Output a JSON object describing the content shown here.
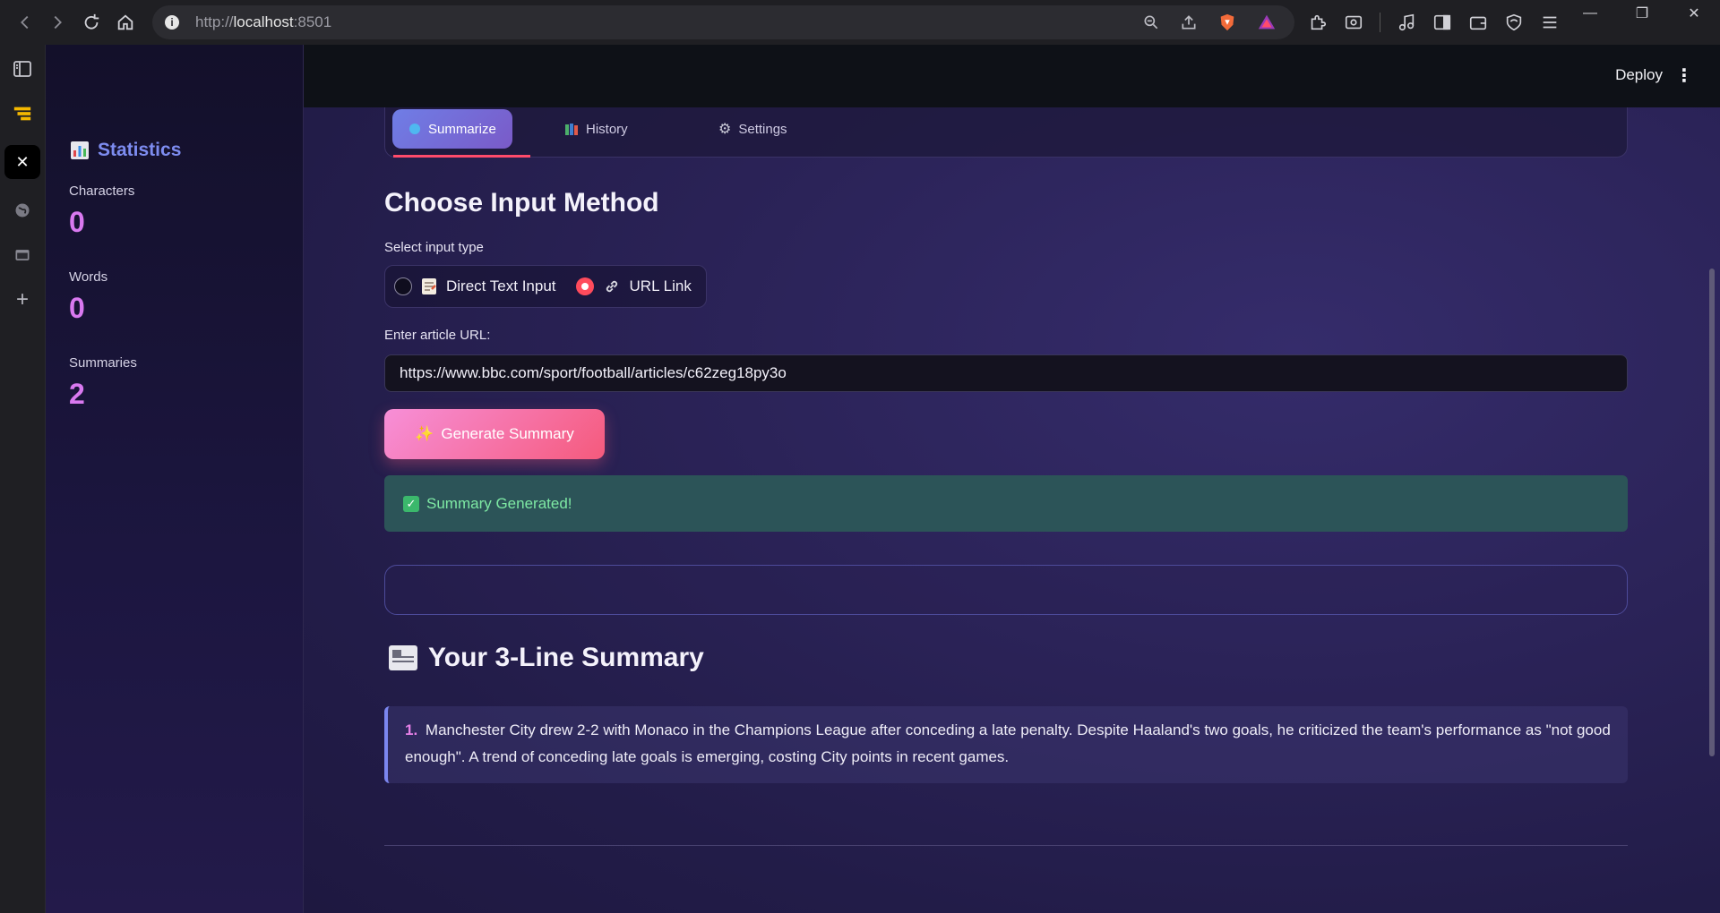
{
  "browser": {
    "url_prefix": "http://",
    "url_host": "localhost",
    "url_port": ":8501"
  },
  "app": {
    "deploy_label": "Deploy"
  },
  "sidebar": {
    "title_icon": "bar-chart-icon",
    "title": "Statistics",
    "stats": [
      {
        "label": "Characters",
        "value": "0"
      },
      {
        "label": "Words",
        "value": "0"
      },
      {
        "label": "Summaries",
        "value": "2"
      }
    ]
  },
  "tabs": [
    {
      "label": "Summarize",
      "icon": "blue-circle-icon",
      "active": true
    },
    {
      "label": "History",
      "icon": "books-icon",
      "active": false
    },
    {
      "label": "Settings",
      "icon": "gear-icon",
      "active": false
    }
  ],
  "input_section": {
    "heading": "Choose Input Method",
    "select_label": "Select input type",
    "options": [
      {
        "label": "Direct Text Input",
        "icon": "memo-icon",
        "selected": false
      },
      {
        "label": "URL Link",
        "icon": "link-icon",
        "selected": true
      }
    ],
    "url_label": "Enter article URL:",
    "url_value": "https://www.bbc.com/sport/football/articles/c62zeg18py3o",
    "generate_label": "Generate Summary",
    "generate_icon": "sparkles-icon"
  },
  "status": {
    "success_text": "Summary Generated!"
  },
  "summary": {
    "heading": "Your 3-Line Summary",
    "heading_icon": "newspaper-icon",
    "items": [
      {
        "number": "1.",
        "text": "Manchester City drew 2-2 with Monaco in the Champions League after conceding a late penalty. Despite Haaland's two goals, he criticized the team's performance as \"not good enough\". A trend of conceding late goals is emerging, costing City points in recent games."
      }
    ]
  },
  "colors": {
    "accent": "#d979f0",
    "tab_active": "#6f7ee6",
    "button_start": "#f78fd8",
    "button_end": "#f55a7c",
    "success_bg": "#2c5458",
    "success_text": "#7ee9a4"
  }
}
